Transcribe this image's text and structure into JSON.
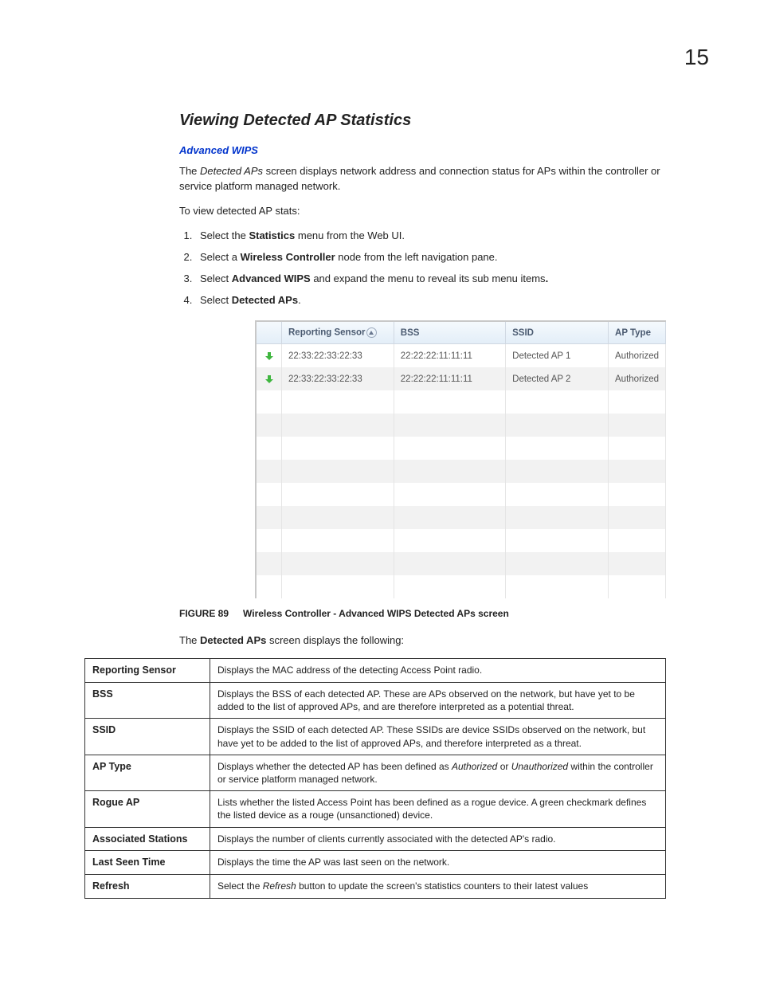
{
  "page_number": "15",
  "section_title": "Viewing Detected AP Statistics",
  "wips_link": "Advanced WIPS",
  "intro_1a": "The ",
  "intro_1b": "Detected APs",
  "intro_1c": " screen displays network address and connection status for APs within the controller or service platform managed network.",
  "intro_2": "To view detected AP stats:",
  "steps": {
    "s1a": "Select the ",
    "s1b": "Statistics",
    "s1c": " menu from the Web UI.",
    "s2a": "Select a ",
    "s2b": "Wireless Controller",
    "s2c": " node from the left navigation pane.",
    "s3a": "Select ",
    "s3b": "Advanced WIPS",
    "s3c": " and expand the menu to reveal its sub menu items",
    "s3d": ".",
    "s4a": "Select ",
    "s4b": "Detected APs",
    "s4c": "."
  },
  "ap_headers": {
    "sensor": "Reporting Sensor",
    "bss": "BSS",
    "ssid": "SSID",
    "aptype": "AP Type"
  },
  "ap_rows": [
    {
      "sensor": "22:33:22:33:22:33",
      "bss": "22:22:22:11:11:11",
      "ssid": "Detected AP 1",
      "aptype": "Authorized"
    },
    {
      "sensor": "22:33:22:33:22:33",
      "bss": "22:22:22:11:11:11",
      "ssid": "Detected AP 2",
      "aptype": "Authorized"
    }
  ],
  "figure_label": "FIGURE 89",
  "figure_title": "Wireless Controller - Advanced WIPS Detected APs screen",
  "displays_a": "The ",
  "displays_b": "Detected APs",
  "displays_c": " screen displays the following:",
  "defs": [
    {
      "term": "Reporting Sensor",
      "desc": "Displays the MAC address of the detecting Access Point radio."
    },
    {
      "term": "BSS",
      "desc": "Displays the BSS of each detected AP. These are APs observed on the network, but have yet to be added to the list of approved APs, and are therefore interpreted as a potential threat."
    },
    {
      "term": "SSID",
      "desc": "Displays the SSID of each detected AP. These SSIDs are device SSIDs observed on the network, but have yet to be added to the list of approved APs, and therefore interpreted as a threat."
    },
    {
      "term": "AP Type",
      "desc_before": "Displays whether the detected AP has been defined as ",
      "ital1": "Authorized",
      "mid": " or ",
      "ital2": "Unauthorized",
      "desc_after": " within the controller or service platform managed network."
    },
    {
      "term": "Rogue AP",
      "desc": "Lists whether the listed Access Point has been defined as a rogue device. A green checkmark defines the listed device as a rouge (unsanctioned) device."
    },
    {
      "term": "Associated Stations",
      "desc": "Displays the number of clients currently associated with the detected AP's radio."
    },
    {
      "term": "Last Seen Time",
      "desc": "Displays the time the AP was last seen on the network."
    },
    {
      "term": "Refresh",
      "desc_before": "Select the ",
      "ital1": "Refresh",
      "desc_after": " button to update the screen's statistics counters to their latest values"
    }
  ]
}
